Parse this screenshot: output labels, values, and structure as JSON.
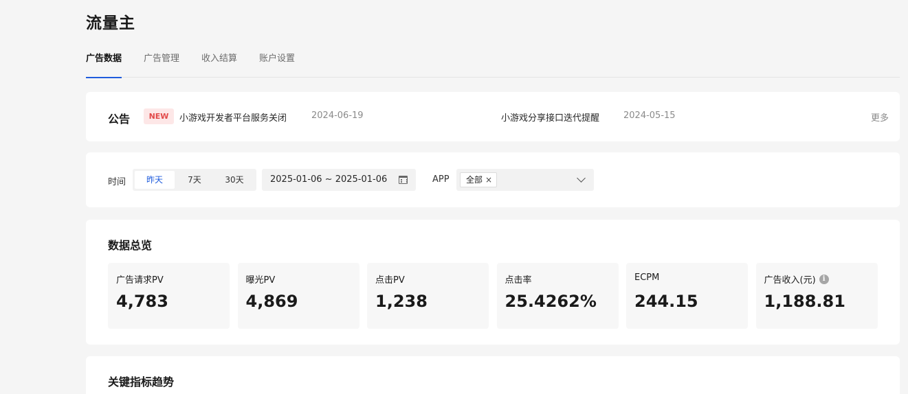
{
  "page": {
    "title": "流量主"
  },
  "tabs": [
    {
      "label": "广告数据",
      "active": true
    },
    {
      "label": "广告管理",
      "active": false
    },
    {
      "label": "收入结算",
      "active": false
    },
    {
      "label": "账户设置",
      "active": false
    }
  ],
  "notice": {
    "title": "公告",
    "badge": "NEW",
    "items": [
      {
        "text": "小游戏开发者平台服务关闭",
        "date": "2024-06-19"
      },
      {
        "text": "小游戏分享接口迭代提醒",
        "date": "2024-05-15"
      }
    ],
    "more_label": "更多"
  },
  "filter": {
    "time_label": "时间",
    "segments": [
      {
        "label": "昨天",
        "active": true
      },
      {
        "label": "7天",
        "active": false
      },
      {
        "label": "30天",
        "active": false
      }
    ],
    "date_range": "2025-01-06 ~ 2025-01-06",
    "app_label": "APP",
    "app_tag": "全部",
    "tag_close": "×"
  },
  "overview": {
    "title": "数据总览",
    "metrics": [
      {
        "label": "广告请求PV",
        "value": "4,783"
      },
      {
        "label": "曝光PV",
        "value": "4,869"
      },
      {
        "label": "点击PV",
        "value": "1,238"
      },
      {
        "label": "点击率",
        "value": "25.4262%"
      },
      {
        "label": "ECPM",
        "value": "244.15"
      },
      {
        "label": "广告收入(元)",
        "value": "1,188.81",
        "info_icon": "i"
      }
    ]
  },
  "trend": {
    "title": "关键指标趋势"
  },
  "colors": {
    "accent": "#1e5bdc",
    "badge_bg": "#fde7e7",
    "badge_text": "#e24a4a"
  },
  "icons": [
    "calendar-icon",
    "chevron-down-icon",
    "info-icon",
    "close-icon"
  ]
}
